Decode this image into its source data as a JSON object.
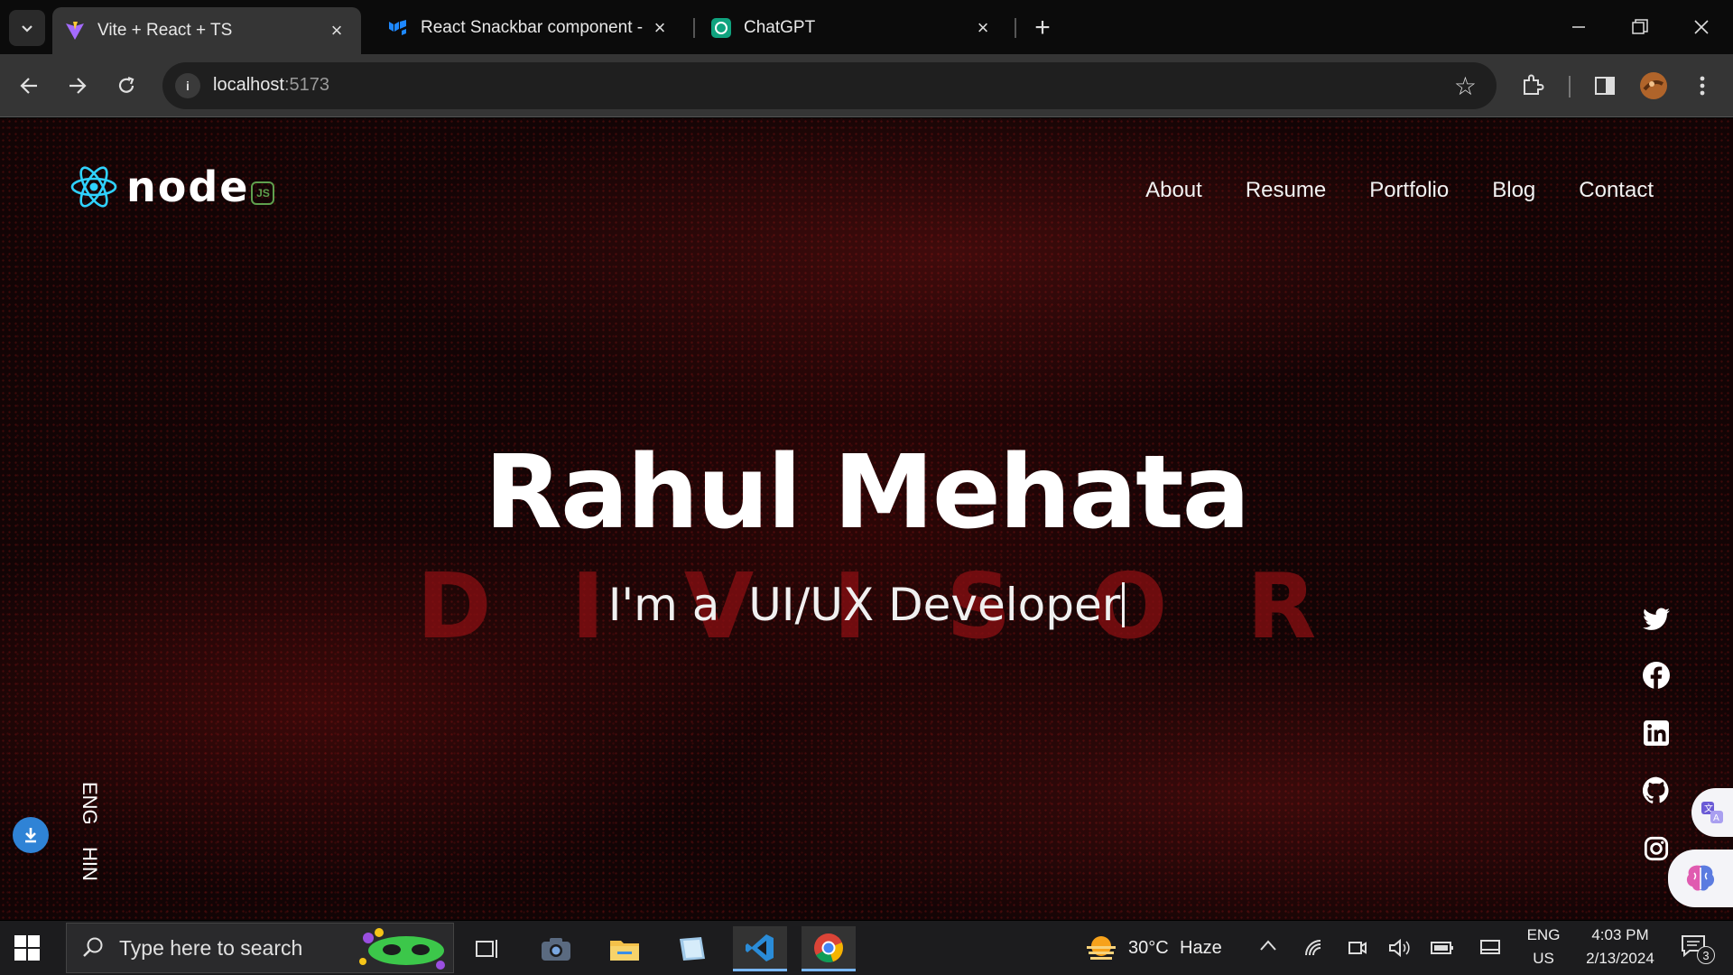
{
  "browser": {
    "tabs": [
      {
        "title": "Vite + React + TS",
        "active": true,
        "icon": "vite-icon"
      },
      {
        "title": "React Snackbar component - M",
        "active": false,
        "icon": "mui-icon"
      },
      {
        "title": "ChatGPT",
        "active": false,
        "icon": "chatgpt-icon"
      }
    ],
    "address": {
      "host": "localhost",
      "port": ":5173"
    }
  },
  "site": {
    "logo_text": "node",
    "logo_badge": "JS",
    "nav": [
      "About",
      "Resume",
      "Portfolio",
      "Blog",
      "Contact"
    ],
    "hero": {
      "name": "Rahul Mehata",
      "subtitle": "I'm a  UI/UX Developer",
      "background_word": "DIVISOR"
    },
    "languages": [
      "ENG",
      "HIN"
    ],
    "social_icons": [
      "twitter-icon",
      "facebook-icon",
      "linkedin-icon",
      "github-icon",
      "instagram-icon"
    ],
    "accent_color": "#8a0f12"
  },
  "taskbar": {
    "search_placeholder": "Type here to search",
    "weather": {
      "temp": "30°C",
      "condition": "Haze"
    },
    "lang": {
      "line1": "ENG",
      "line2": "US"
    },
    "clock": {
      "time": "4:03 PM",
      "date": "2/13/2024"
    },
    "notification_count": "3"
  }
}
